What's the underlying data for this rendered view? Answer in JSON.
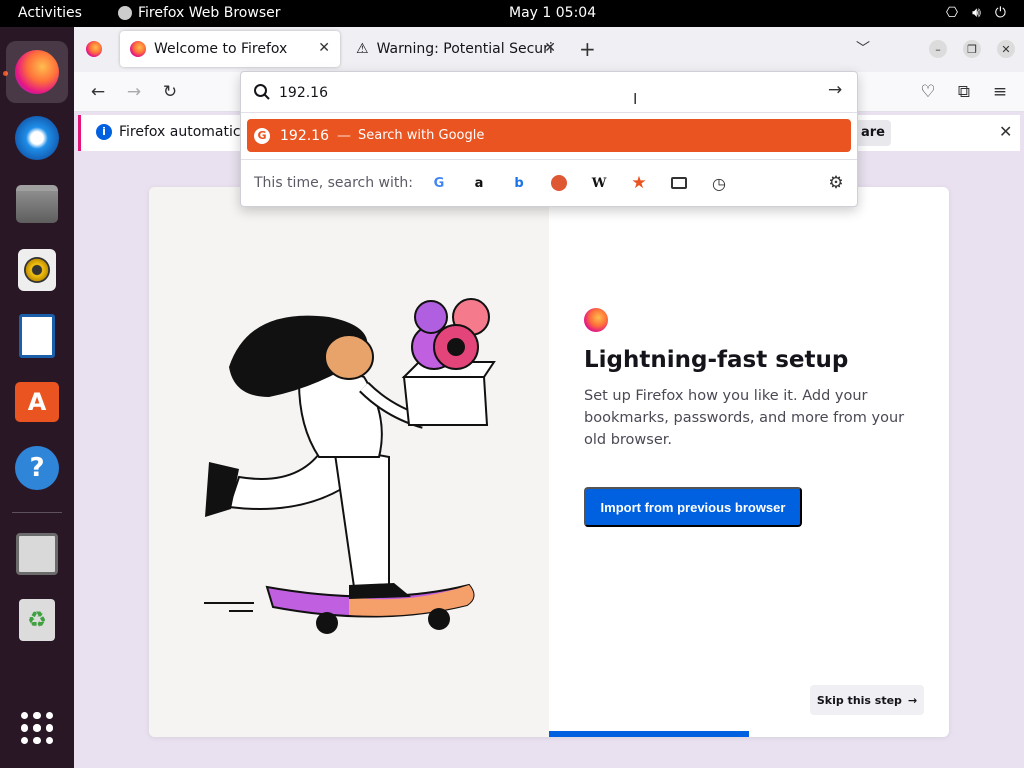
{
  "topbar": {
    "activities": "Activities",
    "app_name": "Firefox Web Browser",
    "clock": "May 1  05:04"
  },
  "dock": {
    "items": [
      "firefox",
      "thunderbird",
      "files",
      "rhythmbox",
      "libreoffice-writer",
      "app-center",
      "help",
      "save-file",
      "trash",
      "show-apps"
    ]
  },
  "tabs": [
    {
      "title": "Welcome to Firefox",
      "selected": true
    },
    {
      "title": "Warning: Potential Securi",
      "selected": false
    }
  ],
  "infobar": {
    "text": "Firefox automatica",
    "button": "are"
  },
  "urlbar": {
    "value": "192.16",
    "suggestion_query": "192.16",
    "suggestion_dash": "—",
    "suggestion_action": "Search with Google",
    "one_off_label": "This time, search with:",
    "one_off_engines": [
      "google",
      "amazon",
      "bing",
      "duckduckgo",
      "wikipedia",
      "bookmarks",
      "tabs",
      "history"
    ]
  },
  "content": {
    "title": "Lightning-fast setup",
    "subtitle": "Set up Firefox how you like it. Add your bookmarks, passwords, and more from your old browser.",
    "import_button": "Import from previous browser",
    "skip_button": "Skip this step",
    "progress": 0.5
  },
  "colors": {
    "accent": "#e95420",
    "primary": "#0061e0",
    "topbar": "#000000",
    "dock": "#2a1726"
  }
}
